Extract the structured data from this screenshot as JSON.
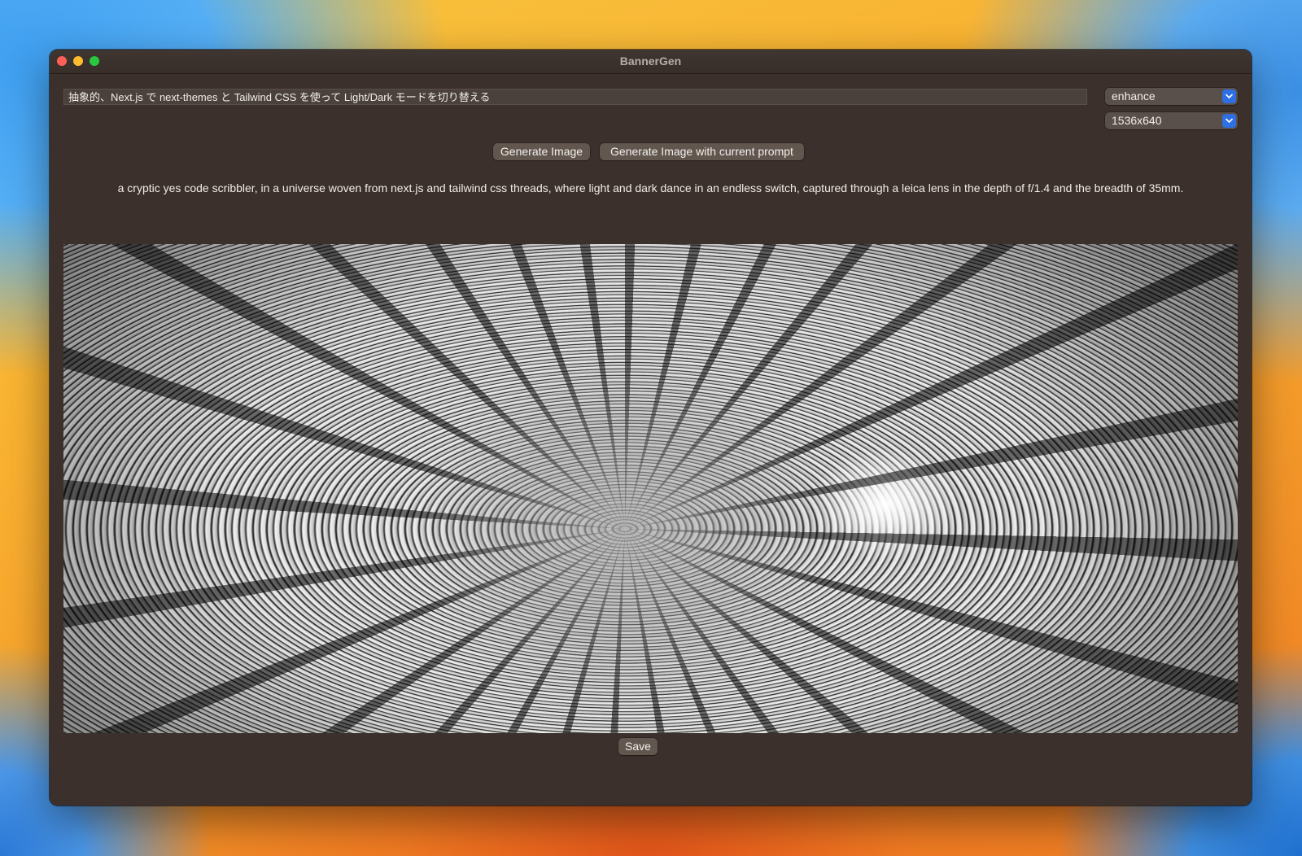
{
  "window": {
    "title": "BannerGen"
  },
  "prompt": {
    "value": "抽象的、Next.js で next-themes と Tailwind CSS を使って Light/Dark モードを切り替える"
  },
  "mode_select": {
    "selected": "enhance"
  },
  "size_select": {
    "selected": "1536x640"
  },
  "actions": {
    "generate_label": "Generate Image",
    "generate_current_label": "Generate Image with current prompt",
    "save_label": "Save"
  },
  "enhanced_prompt": "a cryptic yes code scribbler, in a universe woven from next.js and tailwind css threads, where light and dark dance in an endless switch, captured through a leica lens in the depth of f/1.4 and the breadth of 35mm.",
  "colors": {
    "window_bg": "#3b302b",
    "button_bg": "#62574f",
    "select_accent": "#2f6fe4"
  },
  "icons": {
    "select_indicator": "chevron-down-icon"
  }
}
